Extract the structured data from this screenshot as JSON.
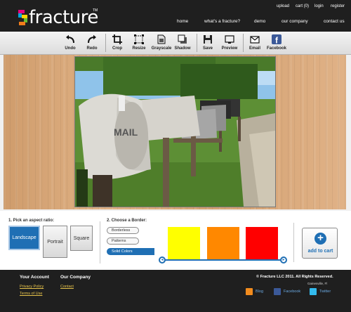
{
  "header": {
    "logo_text": "fracture",
    "logo_tm": "TM",
    "util_links": [
      "upload",
      "cart (0)",
      "login",
      "register"
    ],
    "nav_links": [
      "home",
      "what's a fracture?",
      "demo",
      "our company",
      "contact us"
    ]
  },
  "toolbar": {
    "tools": [
      {
        "label": "Undo",
        "icon": "undo-icon"
      },
      {
        "label": "Redo",
        "icon": "redo-icon"
      },
      {
        "label": "Crop",
        "icon": "crop-icon"
      },
      {
        "label": "Resize",
        "icon": "resize-icon"
      },
      {
        "label": "Grayscale",
        "icon": "grayscale-icon"
      },
      {
        "label": "Shadow",
        "icon": "shadow-icon"
      },
      {
        "label": "Save",
        "icon": "save-icon"
      },
      {
        "label": "Preview",
        "icon": "preview-icon"
      },
      {
        "label": "Email",
        "icon": "email-icon"
      },
      {
        "label": "Facebook",
        "icon": "facebook-icon"
      }
    ]
  },
  "options": {
    "aspect_title": "1. Pick an aspect ratio:",
    "aspect_options": [
      "Landscape",
      "Portrait",
      "Square"
    ],
    "aspect_selected": "Landscape",
    "border_title": "2. Choose a Border:",
    "border_options": [
      "Borderless",
      "Patterns",
      "Solid Colors"
    ],
    "border_selected": "Solid Colors",
    "swatches": [
      "#ffff00",
      "#ff8800",
      "#ff0000"
    ],
    "slider_prev": "◂",
    "slider_next": "▸",
    "cart_plus": "+",
    "cart_label": "add to cart"
  },
  "footer": {
    "account_title": "Your Account",
    "account_links": [
      "Privacy Policy",
      "Terms of Use"
    ],
    "company_title": "Our Company",
    "company_links": [
      "Contact"
    ],
    "copyright": "© Fracture LLC 2011. All Rights Reserved.",
    "location": "Gainesville, Fl",
    "social": [
      {
        "label": "Blog",
        "icon": "rss-icon",
        "color": "#f28c1e"
      },
      {
        "label": "Facebook",
        "icon": "facebook-icon",
        "color": "#3b5998"
      },
      {
        "label": "Twitter",
        "icon": "twitter-icon",
        "color": "#33bbee"
      }
    ]
  },
  "colors": {
    "header_bg": "#1f1f1f",
    "accent_blue": "#1f6fb4",
    "footer_link": "#e6c24a"
  }
}
